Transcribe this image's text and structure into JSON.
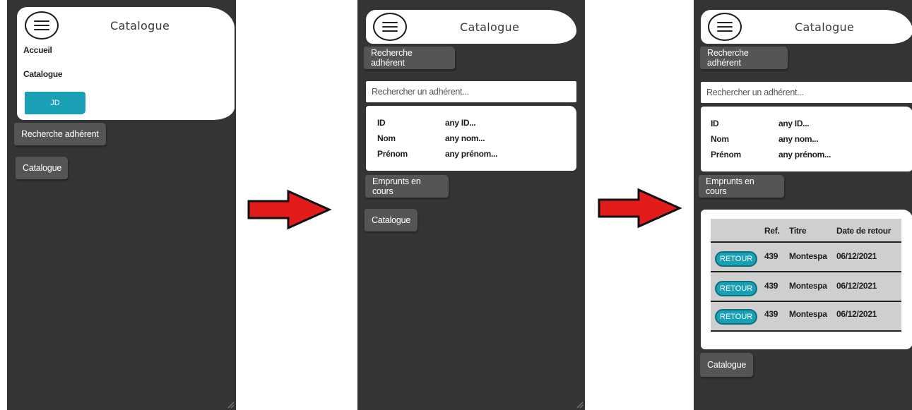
{
  "screen1": {
    "title": "Catalogue",
    "menu_items": [
      "Accueil",
      "Catalogue"
    ],
    "user_button": "JD",
    "buttons": [
      "Recherche adhérent",
      "Catalogue"
    ]
  },
  "screen2": {
    "title": "Catalogue",
    "top_button": "Recherche adhérent",
    "search_placeholder": "Rechercher un adhérent...",
    "fields": [
      {
        "label": "ID",
        "value": "any ID..."
      },
      {
        "label": "Nom",
        "value": "any nom..."
      },
      {
        "label": "Prénom",
        "value": "any prénom..."
      }
    ],
    "buttons": [
      "Emprunts en cours",
      "Catalogue"
    ]
  },
  "screen3": {
    "title": "Catalogue",
    "top_button": "Recherche adhérent",
    "search_placeholder": "Rechercher un adhérent...",
    "fields": [
      {
        "label": "ID",
        "value": "any ID..."
      },
      {
        "label": "Nom",
        "value": "any nom..."
      },
      {
        "label": "Prénom",
        "value": "any prénom..."
      }
    ],
    "loans_button": "Emprunts en cours",
    "table": {
      "headers": [
        "Ref.",
        "Titre",
        "Date de retour"
      ],
      "rows": [
        {
          "action": "RETOUR",
          "ref": "439",
          "titre": "Montespa",
          "date": "06/12/2021"
        },
        {
          "action": "RETOUR",
          "ref": "439",
          "titre": "Montespa",
          "date": "06/12/2021"
        },
        {
          "action": "RETOUR",
          "ref": "439",
          "titre": "Montespa",
          "date": "06/12/2021"
        }
      ]
    },
    "bottom_button": "Catalogue"
  },
  "icons": [
    "hamburger-menu-icon",
    "right-arrow-icon",
    "resize-grip-icon"
  ],
  "colors": {
    "phone_bg": "#343434",
    "accent": "#1aa0b4",
    "arrow": "#e21b1b"
  }
}
